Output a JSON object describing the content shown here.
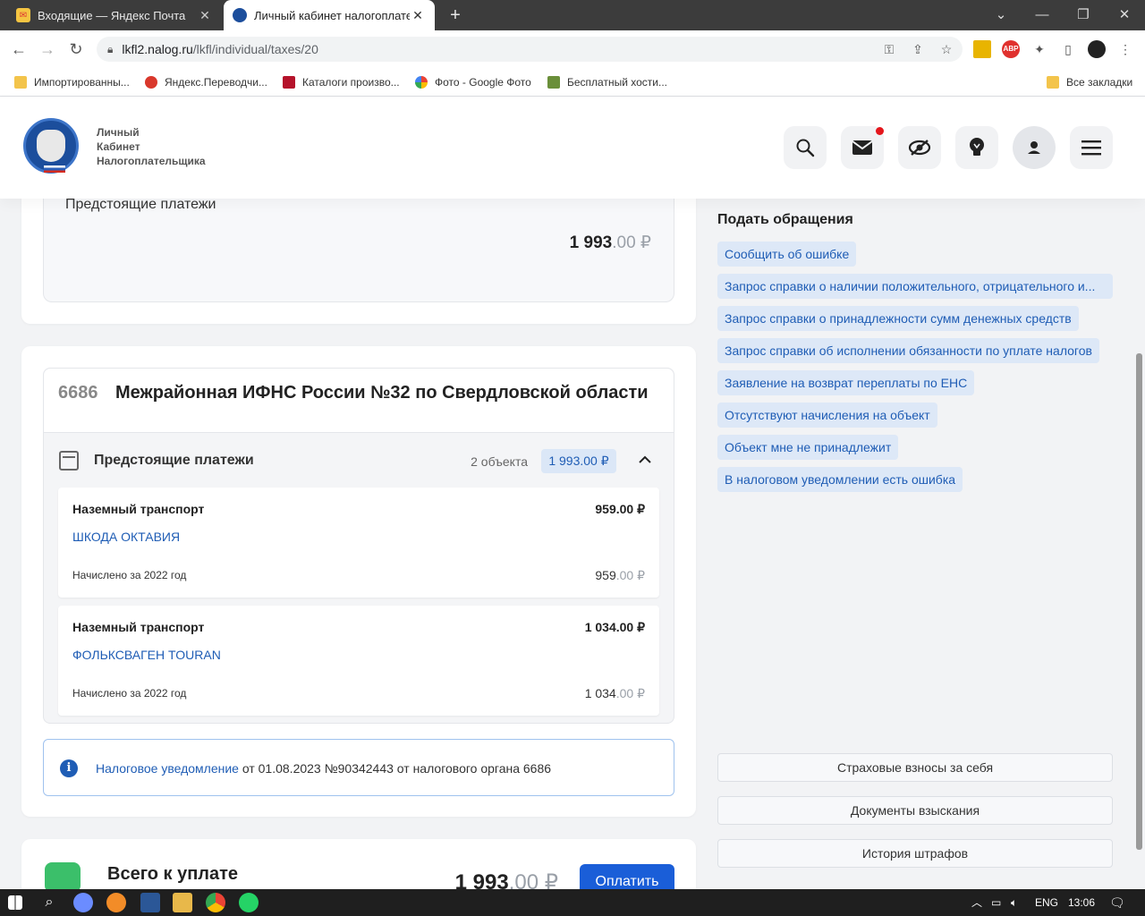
{
  "browser": {
    "tabs": [
      {
        "title": "Входящие — Яндекс Почта",
        "close": "✕"
      },
      {
        "title": "Личный кабинет налогоплател",
        "close": "✕"
      }
    ],
    "new_tab": "+",
    "url_host": "lkfl2.nalog.ru",
    "url_path": "/lkfl/individual/taxes/20",
    "bookmarks": [
      "Импортированны...",
      "Яндекс.Переводчи...",
      "Каталоги произво...",
      "Фото - Google Фото",
      "Бесплатный хости...",
      "Все закладки"
    ]
  },
  "header": {
    "brand_line1": "Личный",
    "brand_line2": "Кабинет",
    "brand_line3": "Налогоплательщика"
  },
  "top_card": {
    "label": "Предстоящие платежи",
    "amount_int": "1 993",
    "amount_frac": ".00 ₽"
  },
  "org": {
    "code": "6686",
    "name": "Межрайонная ИФНС России №32 по Свердловской области",
    "upcoming_label": "Предстоящие платежи",
    "count": "2 объекта",
    "badge": "1 993.00 ₽",
    "items": [
      {
        "type": "Наземный транспорт",
        "amount": "959.00 ₽",
        "car": "ШКОДА ОКТАВИЯ",
        "accrued": "Начислено за 2022 год",
        "accrued_int": "959",
        "accrued_frac": ".00 ₽"
      },
      {
        "type": "Наземный транспорт",
        "amount": "1 034.00 ₽",
        "car": "ФОЛЬКСВАГЕН TOURAN",
        "accrued": "Начислено за 2022 год",
        "accrued_int": "1 034",
        "accrued_frac": ".00 ₽"
      }
    ]
  },
  "notice": {
    "link": "Налоговое уведомление",
    "text": " от 01.08.2023 №90342443 от налогового органа 6686"
  },
  "total": {
    "label": "Всего к уплате",
    "amount_int": "1 993",
    "amount_frac": ".00 ₽",
    "pay": "Оплатить"
  },
  "appeals": {
    "title": "Подать обращения",
    "items": [
      "Сообщить об ошибке",
      "Запрос справки о наличии положительного, отрицательного и...",
      "Запрос справки о принадлежности сумм денежных средств",
      "Запрос справки об исполнении обязанности по уплате налогов",
      "Заявление на возврат переплаты по ЕНС",
      "Отсутствуют начисления на объект",
      "Объект мне не принадлежит",
      "В налоговом уведомлении есть ошибка"
    ]
  },
  "side_buttons": [
    "Страховые взносы за себя",
    "Документы взыскания",
    "История штрафов"
  ],
  "taskbar": {
    "lang": "ENG",
    "time": "13:06"
  },
  "colors": {
    "accent": "#1f5db5",
    "pay_button": "#1a5ed8",
    "chip_bg": "#dde8f7"
  }
}
